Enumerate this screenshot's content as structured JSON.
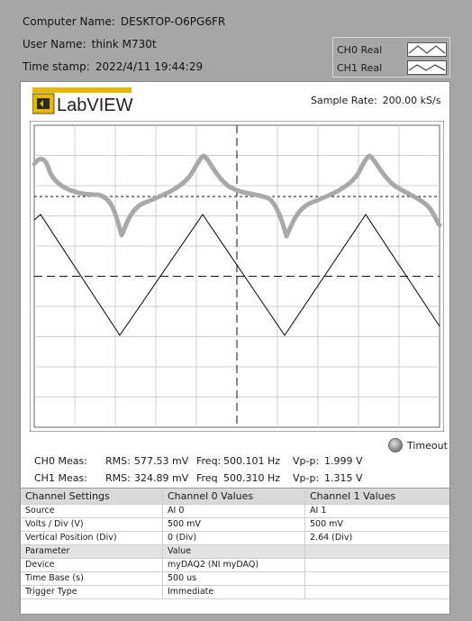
{
  "info": {
    "computer_label": "Computer Name:",
    "computer_value": "DESKTOP-O6PG6FR",
    "user_label": "User Name:",
    "user_value": "think M730t",
    "time_label": "Time stamp:",
    "time_value": "2022/4/11 19:44:29"
  },
  "legend": [
    {
      "label": "CH0 Real"
    },
    {
      "label": "CH1 Real"
    }
  ],
  "logo": {
    "text": "LabVIEW"
  },
  "sample_rate": {
    "label": "Sample Rate:",
    "value": "200.00 kS/s"
  },
  "timeout": {
    "label": "Timeout"
  },
  "measurements": [
    {
      "label": "CH0 Meas:",
      "rms_label": "RMS:",
      "rms": "577.53 mV",
      "freq_label": "Freq:",
      "freq": "500.101 Hz",
      "vpp_label": "Vp-p:",
      "vpp": "1.999 V"
    },
    {
      "label": "CH1 Meas:",
      "rms_label": "RMS:",
      "rms": "324.89 mV",
      "freq_label": "Freq",
      "freq": "500.310 Hz",
      "vpp_label": "Vp-p:",
      "vpp": "1.315 V"
    }
  ],
  "table": {
    "headers": [
      "Channel Settings",
      "Channel 0 Values",
      "Channel 1 Values"
    ],
    "rows": [
      [
        "Source",
        "AI 0",
        "AI 1"
      ],
      [
        "Volts / Div (V)",
        "500 mV",
        "500 mV"
      ],
      [
        "Vertical Position (Div)",
        "0 (Div)",
        "2.64 (Div)"
      ],
      [
        "Parameter",
        "Value",
        ""
      ],
      [
        "Device",
        "myDAQ2 (NI myDAQ)",
        ""
      ],
      [
        "Time Base (s)",
        "500 us",
        ""
      ],
      [
        "Trigger Type",
        "Immediate",
        ""
      ]
    ]
  },
  "colors": {
    "ch0": "#a9a9a9",
    "ch1": "#000000",
    "grid": "#cfcfcf"
  }
}
